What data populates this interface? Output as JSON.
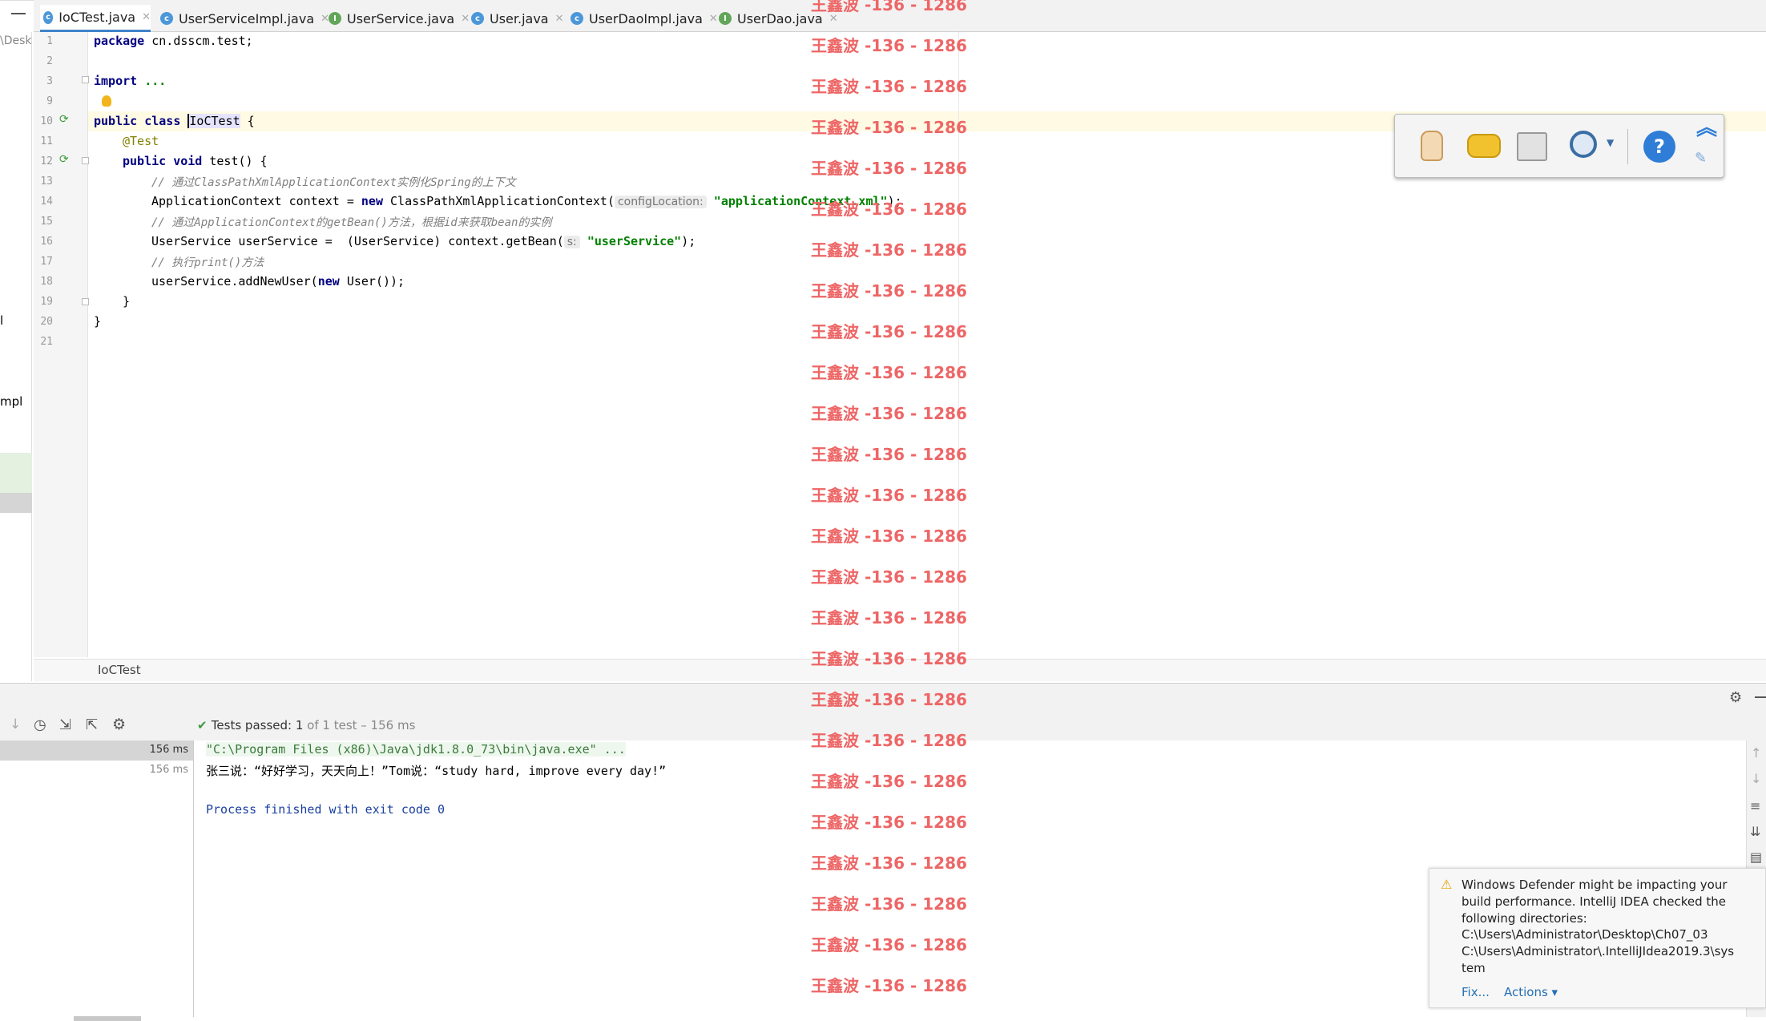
{
  "tabs": [
    {
      "label": "IoCTest.java",
      "type": "c"
    },
    {
      "label": "UserServiceImpl.java",
      "type": "c"
    },
    {
      "label": "UserService.java",
      "type": "i"
    },
    {
      "label": "User.java",
      "type": "c"
    },
    {
      "label": "UserDaoImpl.java",
      "type": "c"
    },
    {
      "label": "UserDao.java",
      "type": "i"
    }
  ],
  "left_panel": {
    "text_desk": "\\Desk",
    "text_l": "l",
    "text_mpl": "mpl"
  },
  "line_numbers": [
    "1",
    "2",
    "3",
    "9",
    "10",
    "11",
    "12",
    "13",
    "14",
    "15",
    "16",
    "17",
    "18",
    "19",
    "20",
    "21"
  ],
  "code": {
    "l1_kw": "package",
    "l1_rest": " cn.dsscm.test;",
    "l3_kw": "import",
    "l3_rest": " ...",
    "l10_kw1": "public",
    "l10_kw2": " class ",
    "l10_cls": "IoCTest",
    "l10_rest": " {",
    "l11": "@Test",
    "l12_kw1": "public",
    "l12_kw2": " void",
    "l12_rest": " test() {",
    "l13": "// 通过ClassPathXmlApplicationContext实例化Spring的上下文",
    "l14_a": "ApplicationContext context = ",
    "l14_new": "new",
    "l14_b": " ClassPathXmlApplicationContext(",
    "l14_hint": "configLocation:",
    "l14_str": "\"applicationContext.xml\"",
    "l14_end": ");",
    "l15": "// 通过ApplicationContext的getBean()方法，根据id来获取bean的实例",
    "l16_a": "UserService userService =  (UserService) context.getBean(",
    "l16_hint": "s:",
    "l16_str": "\"userService\"",
    "l16_end": ");",
    "l17": "// 执行print()方法",
    "l18_a": "userService.addNewUser(",
    "l18_new": "new",
    "l18_b": " User());",
    "l19": "}",
    "l20": "}"
  },
  "breadcrumb": "IoCTest",
  "watermark": "王鑫波 -136 - 1286",
  "run": {
    "status_label": "Tests passed:",
    "status_count": "1",
    "status_rest": " of 1 test – 156 ms",
    "tree": [
      {
        "time": "156 ms"
      },
      {
        "time": "156 ms"
      }
    ],
    "console": [
      "\"C:\\Program Files (x86)\\Java\\jdk1.8.0_73\\bin\\java.exe\" ...",
      "张三说：“好好学习，天天向上！”Tom说：“study hard, improve every day!”",
      "",
      "Process finished with exit code 0"
    ]
  },
  "notification": {
    "text": "Windows Defender might be impacting your build performance. IntelliJ IDEA checked the following directories:",
    "dir1": "C:\\Users\\Administrator\\Desktop\\Ch07_03",
    "dir2": "C:\\Users\\Administrator\\.IntelliJIdea2019.3\\sys",
    "dir2b": "tem",
    "fix": "Fix...",
    "actions": "Actions ▾"
  },
  "colors": {
    "keyword": "#000080",
    "string": "#008000",
    "comment": "#808080",
    "watermark": "#ee6666",
    "caret_line": "#fffae3"
  }
}
